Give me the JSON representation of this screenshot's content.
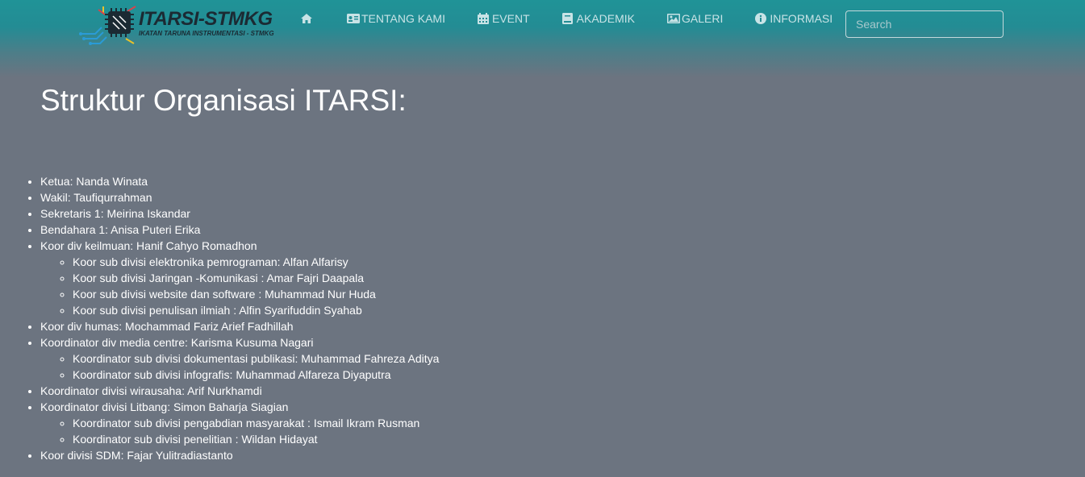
{
  "brand": {
    "title": "ITARSI-STMKG",
    "subtitle": "IKATAN TARUNA INSTRUMENTASI - STMKG",
    "icon": "circuit-chip-logo"
  },
  "nav": {
    "home_icon": "home-icon",
    "items": [
      {
        "label": "TENTANG KAMI",
        "icon": "id-card-icon"
      },
      {
        "label": "EVENT",
        "icon": "calendar-icon"
      },
      {
        "label": "AKADEMIK",
        "icon": "book-icon"
      },
      {
        "label": "GALERI",
        "icon": "image-icon"
      },
      {
        "label": "INFORMASI",
        "icon": "info-circle-icon"
      }
    ]
  },
  "search": {
    "placeholder": "Search",
    "value": ""
  },
  "colors": {
    "navbar_top": "#209397",
    "page_background": "#6c7480",
    "nav_text": "#c8e3e6",
    "text": "#ffffff"
  },
  "page_title": "Struktur Organisasi ITARSI:",
  "structure": [
    {
      "text": "Ketua: Nanda Winata"
    },
    {
      "text": "Wakil: Taufiqurrahman"
    },
    {
      "text": "Sekretaris 1: Meirina Iskandar"
    },
    {
      "text": "Bendahara 1: Anisa Puteri Erika"
    },
    {
      "text": "Koor div keilmuan: Hanif Cahyo Romadhon",
      "sub": [
        "Koor sub divisi elektronika pemrograman: Alfan Alfarisy",
        "Koor sub divisi Jaringan -Komunikasi : Amar Fajri Daapala",
        "Koor sub divisi website dan software : Muhammad Nur Huda",
        "Koor sub divisi penulisan ilmiah : Alfin Syarifuddin Syahab"
      ]
    },
    {
      "text": "Koor div humas: Mochammad Fariz Arief Fadhillah"
    },
    {
      "text": "Koordinator div media centre: Karisma Kusuma Nagari",
      "sub": [
        "Koordinator sub divisi dokumentasi publikasi: Muhammad Fahreza Aditya",
        "Koordinator sub divisi infografis: Muhammad Alfareza Diyaputra"
      ]
    },
    {
      "text": "Koordinator divisi wirausaha: Arif Nurkhamdi"
    },
    {
      "text": "Koordinator divisi Litbang: Simon Baharja Siagian",
      "sub": [
        "Koordinator sub divisi pengabdian masyarakat : Ismail Ikram Rusman",
        "Koordinator sub divisi penelitian : Wildan Hidayat"
      ]
    },
    {
      "text": "Koor divisi SDM: Fajar Yulitradiastanto"
    }
  ]
}
